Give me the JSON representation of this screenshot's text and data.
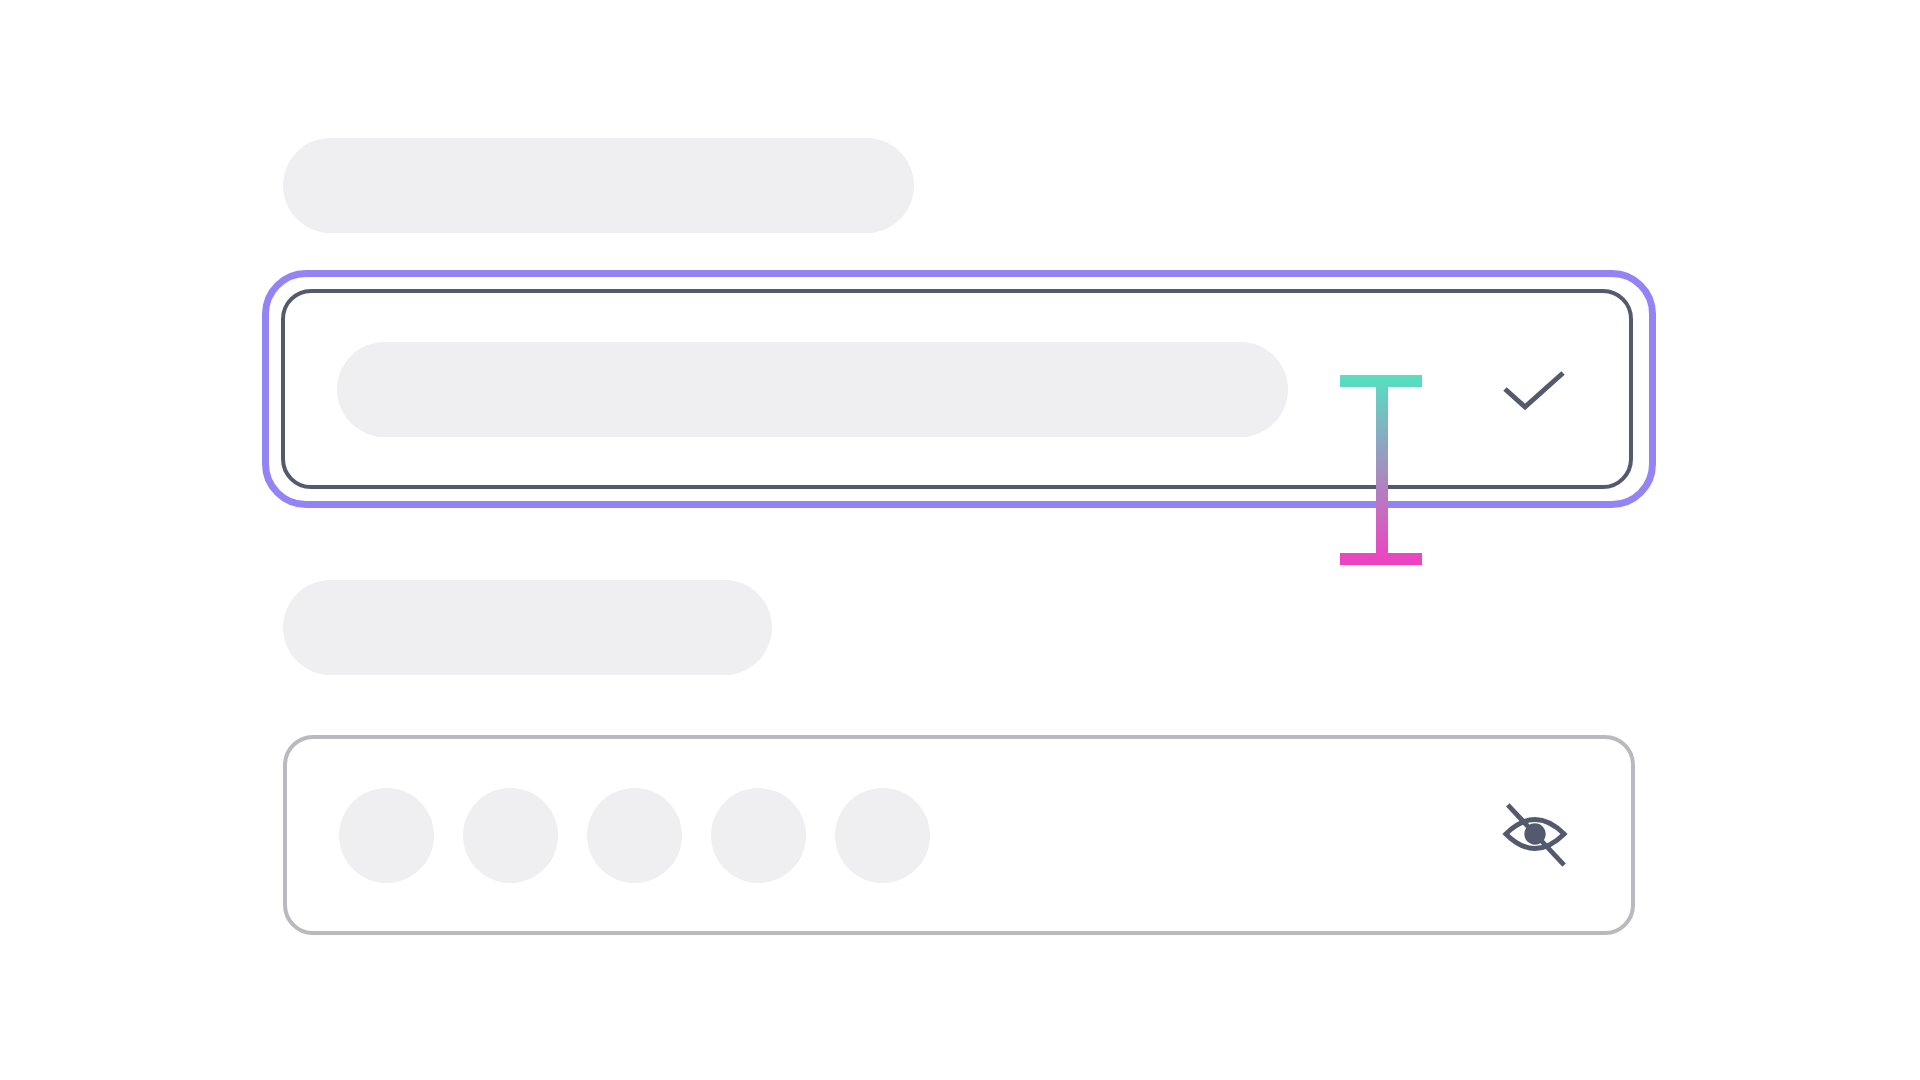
{
  "labels": [
    {
      "kind": "skeleton"
    },
    {
      "kind": "skeleton"
    }
  ],
  "fields": [
    {
      "kind": "text",
      "focused": true,
      "valid": true,
      "cursor": true
    },
    {
      "kind": "password",
      "focused": false,
      "masked": true
    }
  ]
}
